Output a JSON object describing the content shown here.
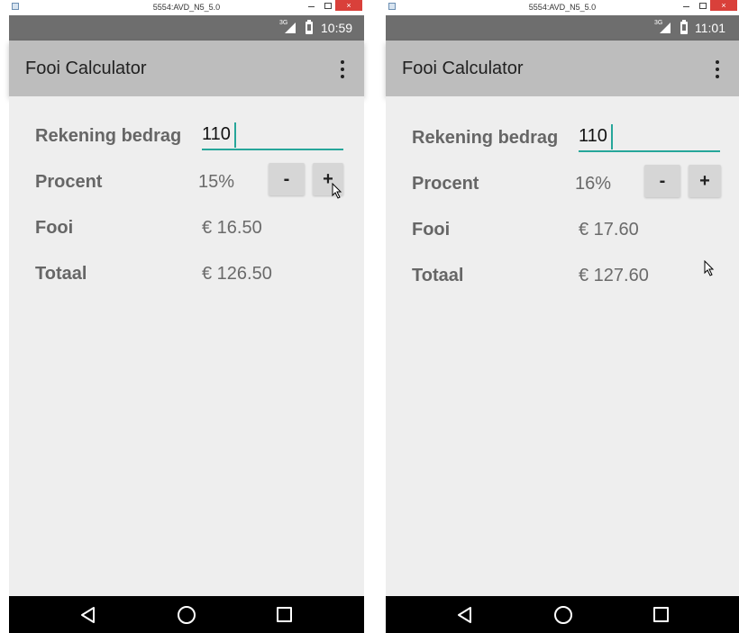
{
  "screens": [
    {
      "window_title": "5554:AVD_N5_5.0",
      "close_glyph": "×",
      "network": "3G",
      "time": "10:59",
      "app_title": "Fooi Calculator",
      "rekening_label": "Rekening bedrag",
      "rekening_value": "110",
      "procent_label": "Procent",
      "procent_value": "15%",
      "minus_label": "-",
      "plus_label": "+",
      "fooi_label": "Fooi",
      "fooi_value": "€ 16.50",
      "totaal_label": "Totaal",
      "totaal_value": "€ 126.50"
    },
    {
      "window_title": "5554:AVD_N5_5.0",
      "close_glyph": "×",
      "network": "3G",
      "time": "11:01",
      "app_title": "Fooi Calculator",
      "rekening_label": "Rekening bedrag",
      "rekening_value": "110",
      "procent_label": "Procent",
      "procent_value": "16%",
      "minus_label": "-",
      "plus_label": "+",
      "fooi_label": "Fooi",
      "fooi_value": "€ 17.60",
      "totaal_label": "Totaal",
      "totaal_value": "€ 127.60"
    }
  ],
  "colors": {
    "accent": "#26a69a",
    "statusbar": "#6e6e6e",
    "appbar": "#bdbdbd",
    "background": "#eeeeee",
    "close_button": "#d9403a"
  },
  "icons": [
    "app-window-icon",
    "minimize-icon",
    "maximize-icon",
    "close-icon",
    "signal-icon",
    "battery-icon",
    "overflow-menu-icon",
    "back-icon",
    "home-icon",
    "recent-apps-icon",
    "mouse-cursor-icon"
  ]
}
